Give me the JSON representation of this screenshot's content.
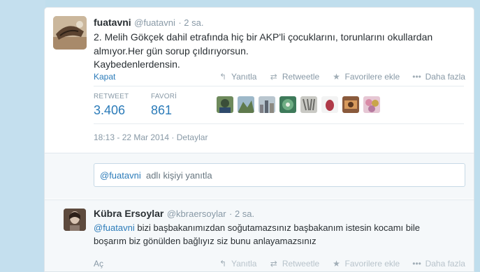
{
  "tweet": {
    "name": "fuatavni",
    "handle": "@fuatavni",
    "time": "· 2 sa.",
    "lines": [
      "2. Melih Gökçek dahil etrafında hiç bir AKP'li çocuklarını, torunlarını okullardan",
      "almıyor.Her gün sorup çıldırıyorsun.",
      "Kaybedenlerdensin."
    ],
    "collapse_label": "Kapat",
    "actions": {
      "reply": "Yanıtla",
      "retweet": "Retweetle",
      "favorite": "Favorilere ekle",
      "more": "Daha fazla"
    },
    "stats": {
      "retweet_label": "RETWEET",
      "retweet_count": "3.406",
      "favorite_label": "FAVORİ",
      "favorite_count": "861"
    },
    "timestamp": "18:13 - 22 Mar 2014",
    "details_label": "· Detaylar"
  },
  "reply_box": {
    "mention": "@fuatavni",
    "rest": "adlı kişiyi yanıtla"
  },
  "reply": {
    "name": "Kübra Ersoylar",
    "handle": "@kbraersoylar",
    "time": "· 2 sa.",
    "mention": "@fuatavni",
    "text_line1": "bizi başbakanımızdan soğutamazsınız başbakanım istesin kocamı bile",
    "text_line2": "boşarım biz gönülden bağlıyız siz bunu anlayamazsınız",
    "open_label": "Aç",
    "actions": {
      "reply": "Yanıtla",
      "retweet": "Retweetle",
      "favorite": "Favorilere ekle",
      "more": "Daha fazla"
    }
  },
  "icons": {
    "reply": "reply-arrow-icon",
    "retweet": "retweet-icon",
    "favorite": "star-icon",
    "more": "ellipsis-icon"
  },
  "colors": {
    "link_blue": "#2b7bb9",
    "muted_gray": "#8899a6",
    "background": "#c0deed"
  }
}
